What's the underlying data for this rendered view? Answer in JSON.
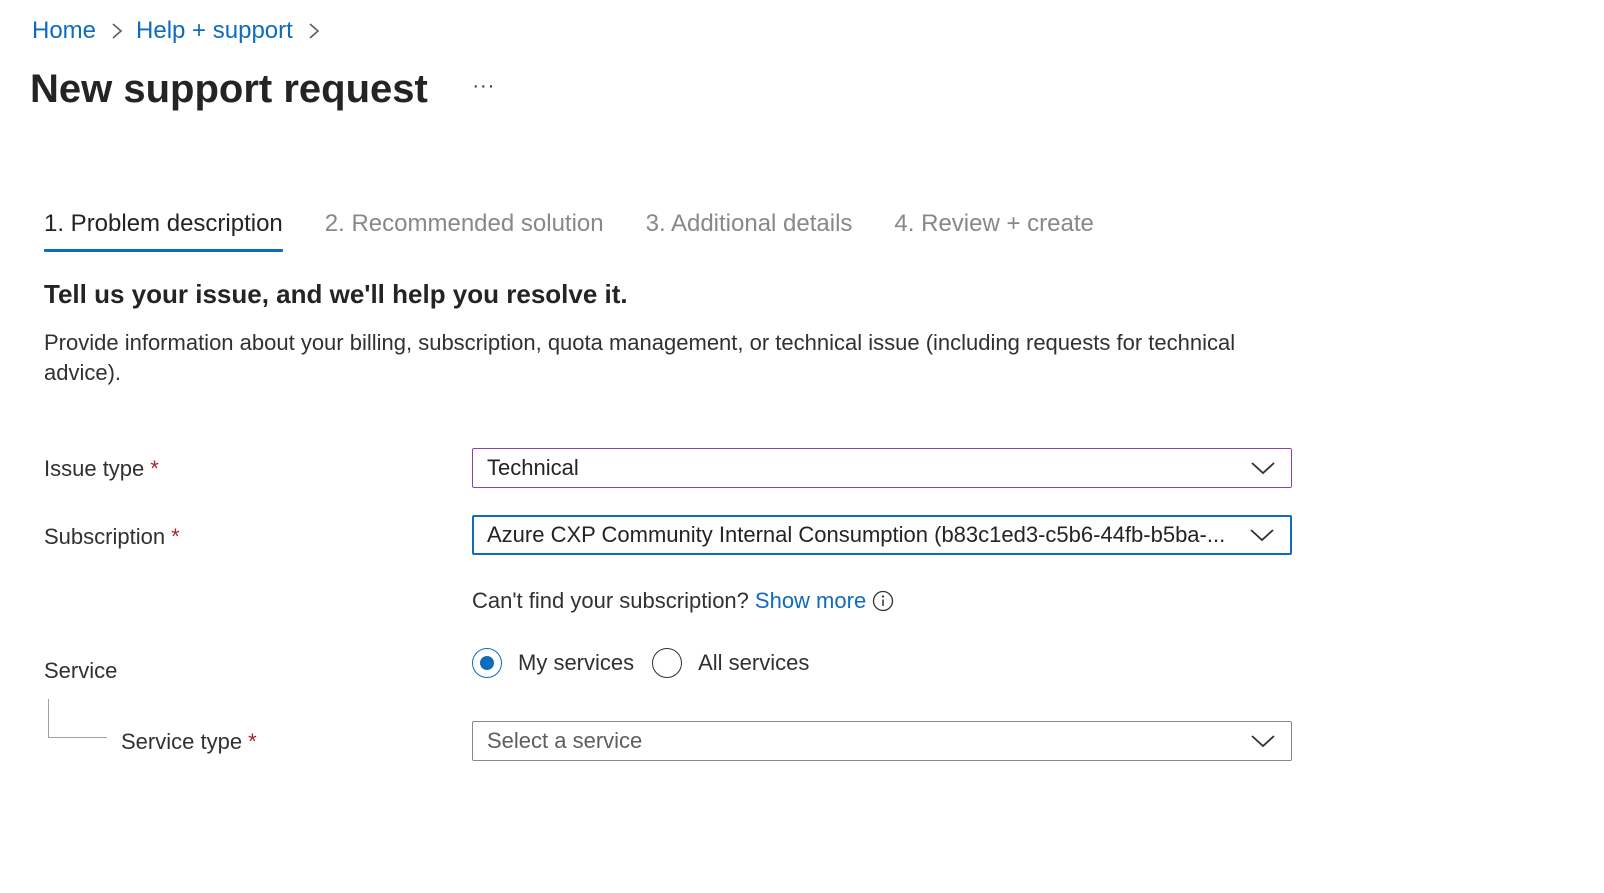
{
  "breadcrumb": {
    "items": [
      {
        "label": "Home"
      },
      {
        "label": "Help + support"
      }
    ]
  },
  "page": {
    "title": "New support request",
    "more_label": "···"
  },
  "tabs": [
    {
      "label": "1. Problem description",
      "active": true
    },
    {
      "label": "2. Recommended solution",
      "active": false
    },
    {
      "label": "3. Additional details",
      "active": false
    },
    {
      "label": "4. Review + create",
      "active": false
    }
  ],
  "section": {
    "heading": "Tell us your issue, and we'll help you resolve it.",
    "description": "Provide information about your billing, subscription, quota management, or technical issue (including requests for technical advice)."
  },
  "form": {
    "issue_type": {
      "label": "Issue type",
      "required_mark": "*",
      "value": "Technical"
    },
    "subscription": {
      "label": "Subscription",
      "required_mark": "*",
      "value": "Azure CXP Community Internal Consumption (b83c1ed3-c5b6-44fb-b5ba-..."
    },
    "cant_find": {
      "text": "Can't find your subscription?",
      "link": "Show more"
    },
    "service": {
      "label": "Service",
      "options": [
        {
          "label": "My services",
          "checked": true
        },
        {
          "label": "All services",
          "checked": false
        }
      ]
    },
    "service_type": {
      "label": "Service type",
      "required_mark": "*",
      "placeholder": "Select a service"
    }
  },
  "colors": {
    "accent": "#0f6cbd",
    "required": "#a4262c",
    "issue_border": "#8e44ad",
    "inactive_tab": "#8a8886"
  },
  "icons": {
    "breadcrumb_separator": "chevron-right-icon",
    "dropdown": "chevron-down-icon",
    "info": "info-icon",
    "more": "more-horizontal-icon"
  }
}
